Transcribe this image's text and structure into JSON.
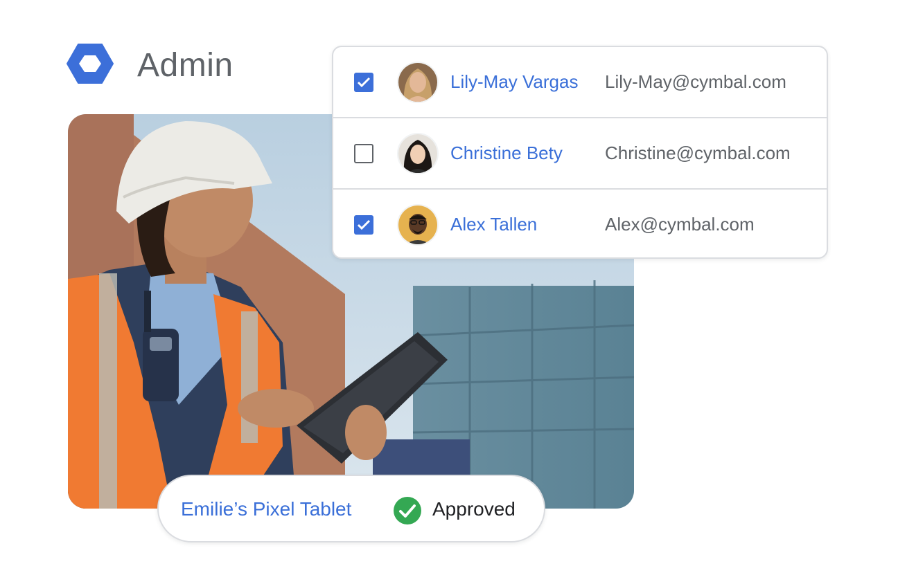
{
  "header": {
    "logo_icon": "admin-hexagon-icon",
    "title": "Admin"
  },
  "colors": {
    "accent": "#3c6fd9",
    "link_text": "#3a6fd8",
    "muted_text": "#5f6368",
    "approved": "#34a853"
  },
  "users": [
    {
      "name": "Lily-May Vargas",
      "email": "Lily-May@cymbal.com",
      "checked": true
    },
    {
      "name": "Christine Bety",
      "email": "Christine@cymbal.com",
      "checked": false
    },
    {
      "name": "Alex Tallen",
      "email": "Alex@cymbal.com",
      "checked": true
    }
  ],
  "approval": {
    "device": "Emilie’s Pixel Tablet",
    "status": "Approved",
    "status_icon": "check-circle-icon"
  }
}
